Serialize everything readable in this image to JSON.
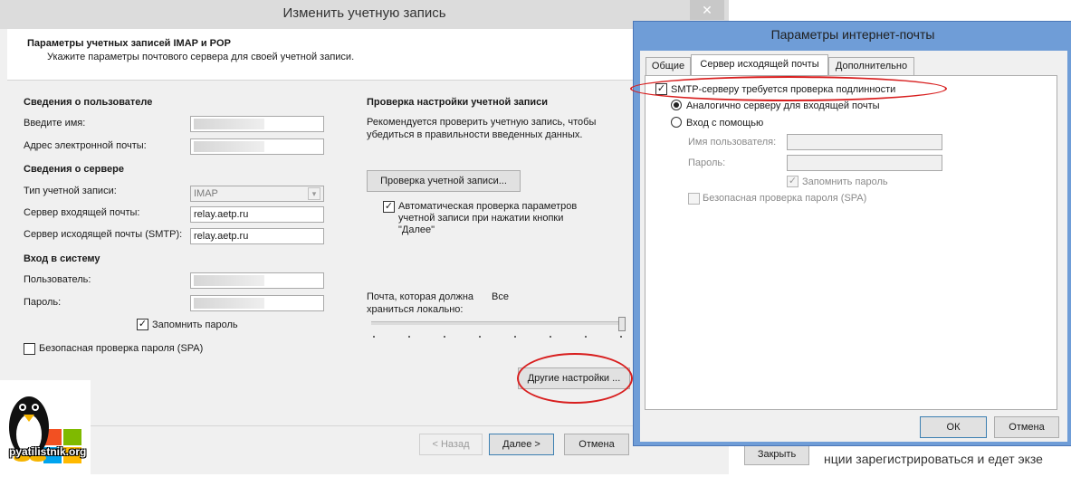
{
  "back_window": {
    "title": "Изменить учетную запись",
    "close": "✕",
    "header_title": "Параметры учетных записей IMAP и POP",
    "header_sub": "Укажите параметры почтового сервера для своей учетной записи.",
    "user_section": "Сведения о пользователе",
    "name_label": "Введите имя:",
    "email_label": "Адрес электронной почты:",
    "server_section": "Сведения о сервере",
    "account_type_label": "Тип учетной записи:",
    "account_type_value": "IMAP",
    "incoming_label": "Сервер входящей почты:",
    "incoming_value": "relay.aetp.ru",
    "outgoing_label": "Сервер исходящей почты (SMTP):",
    "outgoing_value": "relay.aetp.ru",
    "login_section": "Вход в систему",
    "user_label": "Пользователь:",
    "password_label": "Пароль:",
    "remember_label": "Запомнить пароль",
    "spa_label": "Безопасная проверка пароля (SPA)",
    "verify_section": "Проверка настройки учетной записи",
    "verify_text_1": "Рекомендуется проверить учетную запись, чтобы",
    "verify_text_2": "убедиться в правильности введенных данных.",
    "verify_button": "Проверка учетной записи...",
    "auto_check_1": "Автоматическая проверка параметров",
    "auto_check_2": "учетной записи при нажатии кнопки",
    "auto_check_3": "\"Далее\"",
    "mail_local_1": "Почта, которая должна",
    "mail_local_2": "храниться локально:",
    "mail_local_value": "Все",
    "other_settings": "Другие настройки ...",
    "back_button": "< Назад",
    "next_button": "Далее >",
    "cancel_button": "Отмена"
  },
  "front_window": {
    "title": "Параметры интернет-почты",
    "tabs": [
      "Общие",
      "Сервер исходящей почты",
      "Дополнительно"
    ],
    "smtp_auth": "SMTP-серверу требуется проверка подлинности",
    "same_as_incoming": "Аналогично серверу для входящей почты",
    "login_with": "Вход с помощью",
    "username_label": "Имя пользователя:",
    "password_label": "Пароль:",
    "remember_label": "Запомнить пароль",
    "spa_label": "Безопасная проверка пароля (SPA)",
    "ok_button": "ОК",
    "cancel_button": "Отмена"
  },
  "behind": {
    "close_button": "Закрыть",
    "text": "нции зарегистрироваться и едет экзе"
  },
  "logo_text": "pyatilistnik.org",
  "annotation_color": "#d81f1f",
  "icons": {
    "check": "✓",
    "dropdown": "chevron-down-icon"
  }
}
